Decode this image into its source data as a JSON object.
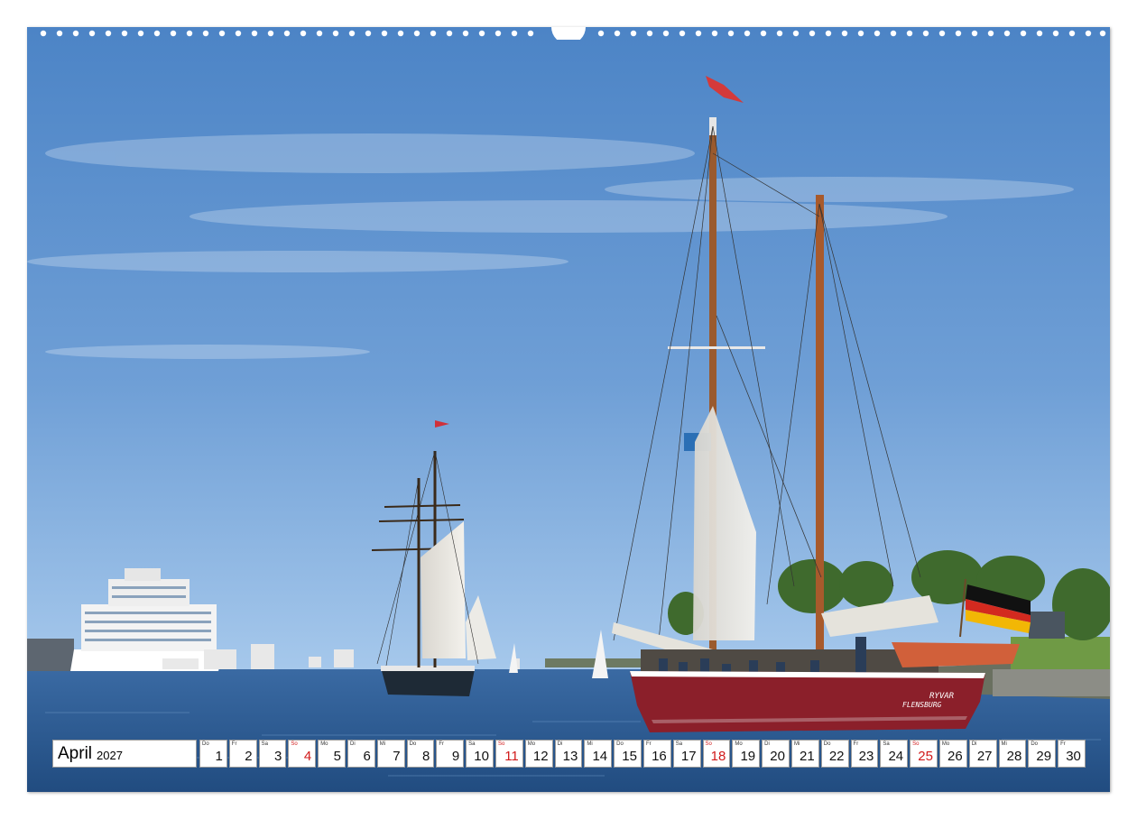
{
  "calendar": {
    "month": "April",
    "year": "2027",
    "days": [
      {
        "wd": "Do",
        "num": "1"
      },
      {
        "wd": "Fr",
        "num": "2"
      },
      {
        "wd": "Sa",
        "num": "3"
      },
      {
        "wd": "So",
        "num": "4",
        "sunday": true
      },
      {
        "wd": "Mo",
        "num": "5"
      },
      {
        "wd": "Di",
        "num": "6"
      },
      {
        "wd": "Mi",
        "num": "7"
      },
      {
        "wd": "Do",
        "num": "8"
      },
      {
        "wd": "Fr",
        "num": "9"
      },
      {
        "wd": "Sa",
        "num": "10"
      },
      {
        "wd": "So",
        "num": "11",
        "sunday": true
      },
      {
        "wd": "Mo",
        "num": "12"
      },
      {
        "wd": "Di",
        "num": "13"
      },
      {
        "wd": "Mi",
        "num": "14"
      },
      {
        "wd": "Do",
        "num": "15"
      },
      {
        "wd": "Fr",
        "num": "16"
      },
      {
        "wd": "Sa",
        "num": "17"
      },
      {
        "wd": "So",
        "num": "18",
        "sunday": true
      },
      {
        "wd": "Mo",
        "num": "19"
      },
      {
        "wd": "Di",
        "num": "20"
      },
      {
        "wd": "Mi",
        "num": "21"
      },
      {
        "wd": "Do",
        "num": "22"
      },
      {
        "wd": "Fr",
        "num": "23"
      },
      {
        "wd": "Sa",
        "num": "24"
      },
      {
        "wd": "So",
        "num": "25",
        "sunday": true
      },
      {
        "wd": "Mo",
        "num": "26"
      },
      {
        "wd": "Di",
        "num": "27"
      },
      {
        "wd": "Mi",
        "num": "28"
      },
      {
        "wd": "Do",
        "num": "29"
      },
      {
        "wd": "Fr",
        "num": "30"
      }
    ]
  },
  "photo": {
    "ship_name": "RYVAR",
    "ship_port": "FLENSBURG"
  },
  "colors": {
    "sky_top": "#4e86c8",
    "sky_bottom": "#9cc3ea",
    "sea": "#2f5f96",
    "hull": "#8b1f2a",
    "sunday": "#d11a1a"
  }
}
